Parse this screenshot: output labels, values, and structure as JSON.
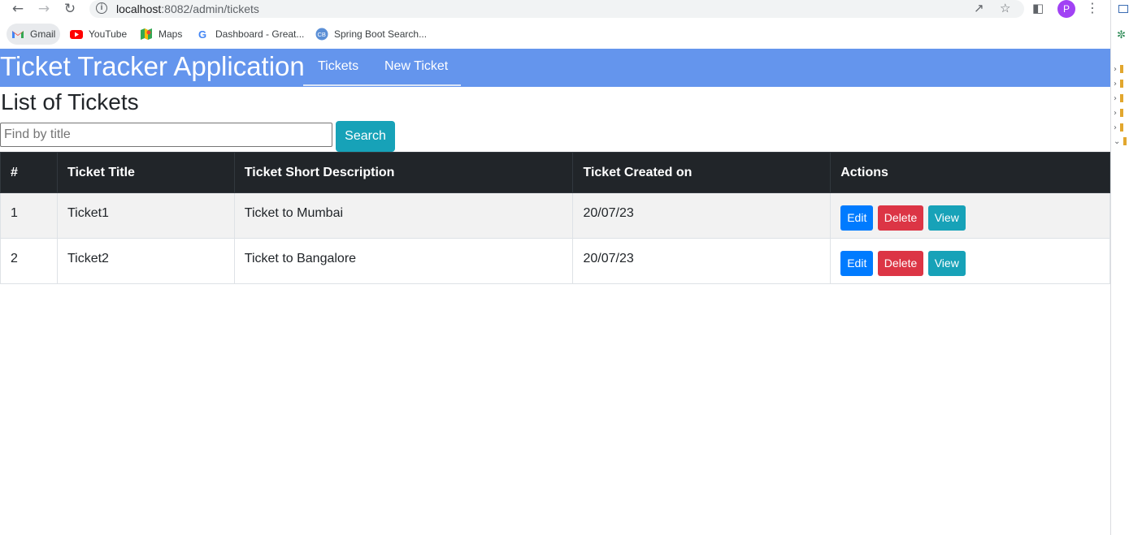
{
  "browser": {
    "url_host": "localhost",
    "url_path": ":8082/admin/tickets",
    "profile_initial": "P",
    "bookmarks": [
      {
        "label": "Gmail",
        "icon": "gmail-icon"
      },
      {
        "label": "YouTube",
        "icon": "youtube-icon"
      },
      {
        "label": "Maps",
        "icon": "maps-icon"
      },
      {
        "label": "Dashboard - Great...",
        "icon": "google-icon"
      },
      {
        "label": "Spring Boot Search...",
        "icon": "cb-icon"
      }
    ]
  },
  "app": {
    "brand": "Ticket Tracker Application",
    "nav": [
      {
        "label": "Tickets"
      },
      {
        "label": "New Ticket"
      }
    ],
    "page_title": "List of Tickets",
    "search": {
      "placeholder": "Find by title",
      "value": "",
      "button_label": "Search"
    },
    "table": {
      "headers": [
        "#",
        "Ticket Title",
        "Ticket Short Description",
        "Ticket Created on",
        "Actions"
      ],
      "rows": [
        {
          "id": "1",
          "title": "Ticket1",
          "description": "Ticket to Mumbai",
          "created": "20/07/23"
        },
        {
          "id": "2",
          "title": "Ticket2",
          "description": "Ticket to Bangalore",
          "created": "20/07/23"
        }
      ],
      "actions": {
        "edit": "Edit",
        "delete": "Delete",
        "view": "View"
      }
    }
  },
  "colors": {
    "navbar": "#6495ed",
    "table_header": "#212529",
    "edit": "#007bff",
    "delete": "#dc3545",
    "view": "#17a2b8"
  }
}
